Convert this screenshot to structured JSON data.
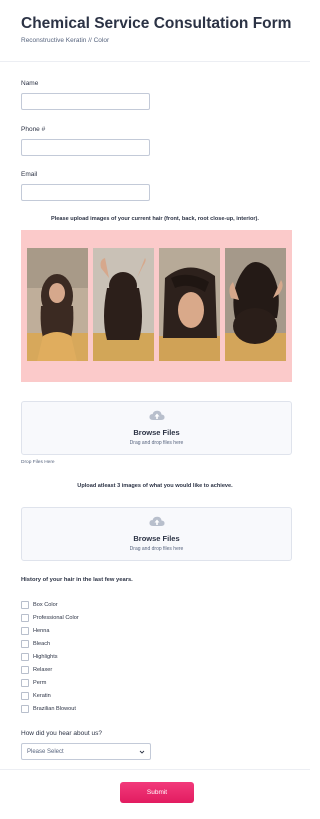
{
  "form": {
    "title": "Chemical Service Consultation Form",
    "subtitle": "Reconstructive Keratin // Color"
  },
  "fields": {
    "name_label": "Name",
    "phone_label": "Phone #",
    "email_label": "Email"
  },
  "current_hair_upload": {
    "heading": "Please upload images of your current hair (front, back, root close-up, interior).",
    "browse_label": "Browse Files",
    "drag_text": "Drag and drop files here",
    "drop_note": "Drop Files Here"
  },
  "goal_upload": {
    "heading": "Upload atleast 3 images of what you would like to achieve.",
    "browse_label": "Browse Files",
    "drag_text": "Drag and drop files here"
  },
  "history": {
    "heading": "History of your hair in the last few years.",
    "options": [
      "Box Color",
      "Professional Color",
      "Henna",
      "Bleach",
      "Highlights",
      "Relaxer",
      "Perm",
      "Keratin",
      "Brazilian Blowout"
    ]
  },
  "referral": {
    "label": "How did you hear about us?",
    "selected": "Please Select"
  },
  "submit_label": "Submit",
  "colors": {
    "accent": "#e21c60",
    "photo_panel_bg": "#fbcaca",
    "text": "#2c3345"
  }
}
